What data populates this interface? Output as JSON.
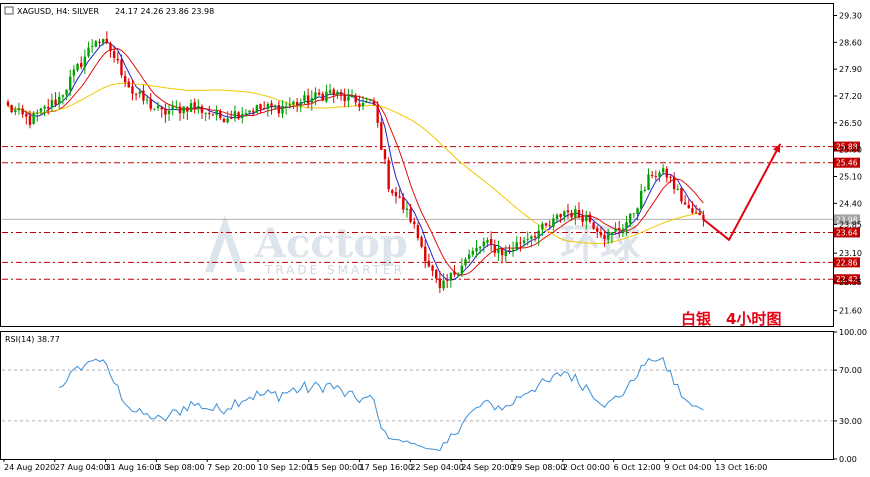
{
  "header": {
    "symbol": "XAGUSD, H4:",
    "description": "SILVER",
    "ohlc": "24.17 24.26 23.86 23.98"
  },
  "watermark": {
    "brand": "Acctop",
    "cn": "环球",
    "tagline": "TRADE SMARTER"
  },
  "annotation": "白银　4小时图",
  "colors": {
    "bull": "#00a000",
    "bear": "#e00000",
    "ma_fast": "#1f1fcc",
    "ma_mid": "#e01010",
    "ma_slow": "#f0c800",
    "rsi": "#3a8fd8",
    "levels": "#c00000",
    "forecast": "#e60012"
  },
  "chart_data": [
    {
      "type": "candlestick",
      "symbol": "XAGUSD",
      "timeframe": "H4",
      "ylim": [
        21.2,
        29.6
      ],
      "yticks": [
        21.6,
        22.35,
        23.1,
        23.85,
        24.4,
        25.1,
        25.8,
        26.5,
        27.2,
        27.9,
        28.6,
        29.3
      ],
      "ytick_labels": [
        "21.60",
        "22.35",
        "23.10",
        "23.85",
        "24.40",
        "25.10",
        "25.80",
        "26.50",
        "27.20",
        "27.90",
        "28.60",
        "29.30"
      ],
      "xtick_labels": [
        "24 Aug 2020",
        "27 Aug 04:00",
        "31 Aug 16:00",
        "3 Sep 08:00",
        "7 Sep 20:00",
        "10 Sep 12:00",
        "15 Sep 00:00",
        "17 Sep 16:00",
        "22 Sep 04:00",
        "24 Sep 20:00",
        "29 Sep 08:00",
        "2 Oct 00:00",
        "6 Oct 12:00",
        "9 Oct 04:00",
        "13 Oct 16:00"
      ],
      "current_price": 23.98,
      "current_price_label": "23.98",
      "levels": [
        {
          "value": 25.88,
          "label": "25.88"
        },
        {
          "value": 25.46,
          "label": "25.46"
        },
        {
          "value": 23.64,
          "label": "23.64"
        },
        {
          "value": 22.86,
          "label": "22.86"
        },
        {
          "value": 22.42,
          "label": "22.42"
        }
      ],
      "anchors": [
        [
          0,
          26.9
        ],
        [
          6,
          26.55
        ],
        [
          14,
          27.15
        ],
        [
          24,
          28.7
        ],
        [
          28,
          28.4
        ],
        [
          34,
          27.3
        ],
        [
          42,
          26.75
        ],
        [
          50,
          26.95
        ],
        [
          58,
          26.65
        ],
        [
          66,
          26.85
        ],
        [
          74,
          26.9
        ],
        [
          82,
          27.1
        ],
        [
          88,
          27.3
        ],
        [
          94,
          27.05
        ],
        [
          100,
          26.95
        ],
        [
          104,
          24.9
        ],
        [
          110,
          24.0
        ],
        [
          118,
          22.1
        ],
        [
          124,
          22.85
        ],
        [
          130,
          23.35
        ],
        [
          136,
          23.1
        ],
        [
          142,
          23.55
        ],
        [
          148,
          23.8
        ],
        [
          152,
          24.2
        ],
        [
          158,
          24.05
        ],
        [
          164,
          23.5
        ],
        [
          170,
          24.0
        ],
        [
          176,
          25.2
        ],
        [
          180,
          25.15
        ],
        [
          186,
          24.2
        ],
        [
          190,
          23.98
        ]
      ],
      "bar_count": 191,
      "moving_averages": [
        {
          "period": 5,
          "color_key": "ma_fast"
        },
        {
          "period": 10,
          "color_key": "ma_mid"
        },
        {
          "period": 50,
          "color_key": "ma_slow"
        }
      ],
      "forecast_path": [
        [
          190,
          23.98
        ],
        [
          197,
          23.45
        ],
        [
          211,
          25.95
        ]
      ]
    },
    {
      "type": "line",
      "title": "RSI(14) 38.77",
      "ylim": [
        0,
        100
      ],
      "yticks": [
        0,
        30,
        70,
        100
      ],
      "ytick_labels": [
        "0.00",
        "30.00",
        "70.00",
        "100.00"
      ],
      "period": 14,
      "last_value": 38.77
    }
  ]
}
